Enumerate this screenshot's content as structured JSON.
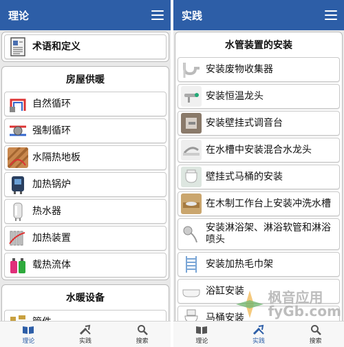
{
  "left": {
    "title": "理论",
    "top_item": {
      "label": "术语和定义",
      "icon": "document-icon"
    },
    "housing_section": {
      "header": "房屋供暖",
      "items": [
        {
          "label": "自然循环",
          "icon": "natural-circulation-icon"
        },
        {
          "label": "强制循环",
          "icon": "forced-circulation-icon"
        },
        {
          "label": "水隔热地板",
          "icon": "floor-heating-icon"
        },
        {
          "label": "加热锅炉",
          "icon": "boiler-icon"
        },
        {
          "label": "热水器",
          "icon": "water-heater-icon"
        },
        {
          "label": "加热装置",
          "icon": "radiator-icon"
        },
        {
          "label": "载热流体",
          "icon": "fluid-bottles-icon"
        }
      ]
    },
    "plumbing_section": {
      "header": "水暖设备",
      "items": [
        {
          "label": "管件",
          "icon": "fittings-icon"
        }
      ]
    }
  },
  "right": {
    "title": "实践",
    "section": {
      "header": "水管装置的安装",
      "items": [
        {
          "label": "安装废物收集器",
          "icon": "drain-trap-icon"
        },
        {
          "label": "安装恒温龙头",
          "icon": "thermostatic-faucet-icon"
        },
        {
          "label": "安装壁挂式调音台",
          "icon": "wall-mixer-icon"
        },
        {
          "label": "在水槽中安装混合水龙头",
          "icon": "sink-mixer-icon"
        },
        {
          "label": "壁挂式马桶的安装",
          "icon": "wall-toilet-icon"
        },
        {
          "label": "在木制工作台上安装冲洗水槽",
          "icon": "wooden-sink-icon"
        },
        {
          "label": "安装淋浴架、淋浴软管和淋浴喷头",
          "icon": "shower-icon"
        },
        {
          "label": "安装加热毛巾架",
          "icon": "towel-rail-icon"
        },
        {
          "label": "浴缸安装",
          "icon": "bathtub-icon"
        },
        {
          "label": "马桶安装",
          "icon": "toilet-icon"
        }
      ]
    }
  },
  "tabs": [
    {
      "label": "理论",
      "icon": "book-icon"
    },
    {
      "label": "实践",
      "icon": "tools-icon"
    },
    {
      "label": "搜索",
      "icon": "search-icon"
    }
  ],
  "watermark": {
    "line1": "枫音应用",
    "line2": "fyGb.com"
  },
  "colors": {
    "appbar": "#2d5ea7",
    "background": "#e9e9e9"
  }
}
